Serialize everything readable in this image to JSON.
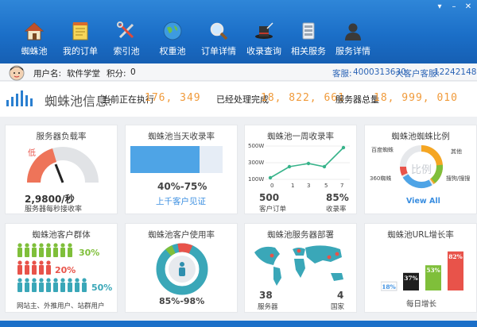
{
  "colors": {
    "brand": "#1b6fc8",
    "orange": "#f09a3a",
    "green": "#7fbf3a",
    "red": "#e8534a",
    "teal": "#3aa7b8",
    "blue": "#4ea4e6"
  },
  "nav": [
    {
      "label": "蜘蛛池",
      "icon": "house-icon"
    },
    {
      "label": "我的订单",
      "icon": "notepad-icon"
    },
    {
      "label": "索引池",
      "icon": "tools-icon"
    },
    {
      "label": "权重池",
      "icon": "globe-icon"
    },
    {
      "label": "订单详情",
      "icon": "magnifier-icon"
    },
    {
      "label": "收录查询",
      "icon": "magic-hat-icon"
    },
    {
      "label": "相关服务",
      "icon": "phone-icon"
    },
    {
      "label": "服务详情",
      "icon": "person-icon"
    }
  ],
  "user": {
    "name_label": "用户名:",
    "name": "软件学堂",
    "points_label": "积分:",
    "points": "0",
    "service_label": "客服:",
    "service_qq": "4000313630",
    "vip_label": "大客户客服:",
    "vip_qq": "122421489"
  },
  "info": {
    "title": "蜘蛛池信息:",
    "running_label": "当前正在执行",
    "running": "176, 349",
    "done_label": "已经处理完成",
    "done": "18, 822, 661",
    "total_label": "服务器总量",
    "total": "18, 999, 010"
  },
  "cards": {
    "load": {
      "title": "服务器负载率",
      "gauge_label": "低",
      "value": "2,9800/秒",
      "caption": "服务器每秒接收率",
      "level": 0.35
    },
    "daily": {
      "title": "蜘蛛池当天收录率",
      "range": "40%-75%",
      "link": "上千客户见证",
      "fill": 0.75
    },
    "weekly": {
      "title": "蜘蛛池一周收录率",
      "y_labels": [
        "500W",
        "300W",
        "100W"
      ],
      "x_labels": [
        "0",
        "1",
        "3",
        "5",
        "7"
      ],
      "left_value": "500",
      "left_caption": "客户订单",
      "right_value": "85%",
      "right_caption": "收录率"
    },
    "ratio": {
      "title": "蜘蛛池蜘蛛比例",
      "center": "比例",
      "labels": [
        "百度蜘蛛",
        "其他",
        "360蜘蛛",
        "搜狗/搜搜"
      ],
      "link": "View All"
    },
    "groups": {
      "title": "蜘蛛池客户群体",
      "pct1": "30%",
      "pct2": "20%",
      "pct3": "50%",
      "caption": "网站主、外推用户、站群用户"
    },
    "usage": {
      "title": "蜘蛛池客户使用率",
      "range": "85%-98%"
    },
    "servers": {
      "title": "蜘蛛池服务器部署",
      "left_value": "38",
      "left_caption": "服务器",
      "right_value": "4",
      "right_caption": "国家"
    },
    "growth": {
      "title": "蜘蛛池URL增长率",
      "bars": [
        "18%",
        "37%",
        "53%",
        "82%"
      ],
      "caption": "每日增长"
    }
  },
  "chart_data": {
    "type": "bar",
    "title": "蜘蛛池URL增长率",
    "categories": [
      "1",
      "2",
      "3",
      "4"
    ],
    "values": [
      18,
      37,
      53,
      82
    ],
    "ylim": [
      0,
      100
    ]
  }
}
